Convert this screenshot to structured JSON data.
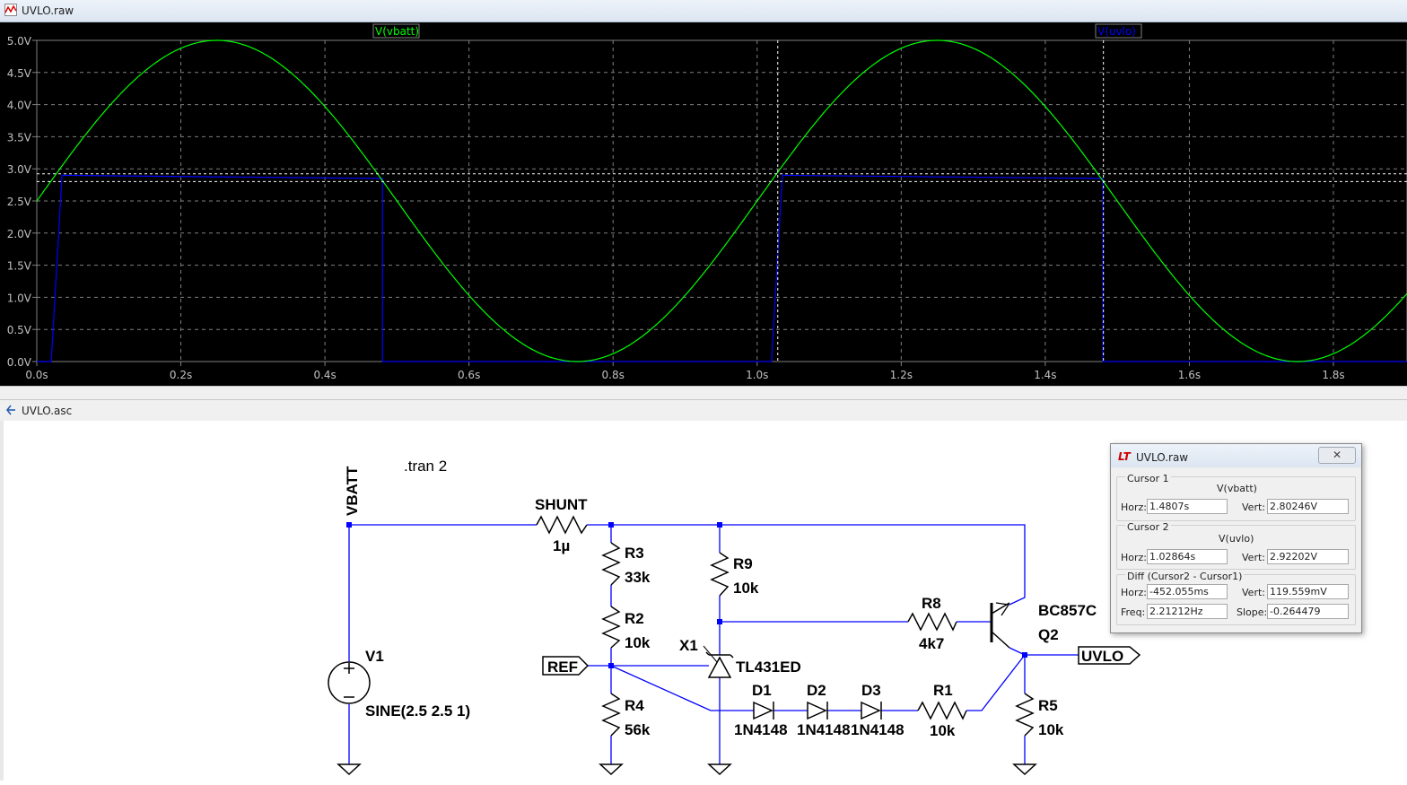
{
  "waveform_window": {
    "title": "UVLO.raw",
    "traces": [
      {
        "label": "V(vbatt)",
        "color": "#00ff00"
      },
      {
        "label": "V(uvlo)",
        "color": "#0000ff"
      }
    ],
    "y_ticks": [
      "0.0V",
      "0.5V",
      "1.0V",
      "1.5V",
      "2.0V",
      "2.5V",
      "3.0V",
      "3.5V",
      "4.0V",
      "4.5V",
      "5.0V"
    ],
    "x_ticks": [
      "0.0s",
      "0.2s",
      "0.4s",
      "0.6s",
      "0.8s",
      "1.0s",
      "1.2s",
      "1.4s",
      "1.6s",
      "1.8s"
    ]
  },
  "chart_data": {
    "type": "line",
    "x_range": [
      0,
      1.95
    ],
    "ylim": [
      0,
      5
    ],
    "grid": true,
    "series": [
      {
        "name": "V(vbatt)",
        "formula": "2.5 + 2.5*sin(2*pi*t)",
        "color": "#00ff00"
      },
      {
        "name": "V(uvlo)",
        "color": "#0000ff",
        "points": [
          [
            0,
            0
          ],
          [
            0.02,
            0
          ],
          [
            0.035,
            2.9
          ],
          [
            0.48,
            2.85
          ],
          [
            0.48,
            0
          ],
          [
            1.02,
            0
          ],
          [
            1.035,
            2.9
          ],
          [
            1.48,
            2.85
          ],
          [
            1.48,
            0
          ],
          [
            1.95,
            0
          ]
        ]
      }
    ],
    "cursors": {
      "cursor1_x": 1.4807,
      "cursor1_y": 2.80246,
      "cursor2_x": 1.02864,
      "cursor2_y": 2.92202
    }
  },
  "schematic_window": {
    "title": "UVLO.asc",
    "directive": ".tran 2",
    "nets": {
      "vbatt": "VBATT",
      "ref": "REF",
      "uvlo": "UVLO"
    },
    "components": {
      "shunt": {
        "name": "SHUNT",
        "value": "1µ"
      },
      "r3": {
        "name": "R3",
        "value": "33k"
      },
      "r2": {
        "name": "R2",
        "value": "10k"
      },
      "r4": {
        "name": "R4",
        "value": "56k"
      },
      "r9": {
        "name": "R9",
        "value": "10k"
      },
      "r8": {
        "name": "R8",
        "value": "4k7"
      },
      "r1": {
        "name": "R1",
        "value": "10k"
      },
      "r5": {
        "name": "R5",
        "value": "10k"
      },
      "x1": {
        "name": "X1",
        "value": "TL431ED"
      },
      "q2": {
        "name": "Q2",
        "value": "BC857C"
      },
      "v1": {
        "name": "V1",
        "value": "SINE(2.5 2.5 1)"
      },
      "d1": {
        "name": "D1",
        "value": "1N4148"
      },
      "d2": {
        "name": "D2",
        "value": "1N4148"
      },
      "d3": {
        "name": "D3",
        "value": "1N4148"
      }
    }
  },
  "cursor_dialog": {
    "title": "UVLO.raw",
    "close": "✕",
    "cursor1": {
      "label": "Cursor 1",
      "signal": "V(vbatt)",
      "horz_label": "Horz:",
      "horz": "1.4807s",
      "vert_label": "Vert:",
      "vert": "2.80246V"
    },
    "cursor2": {
      "label": "Cursor 2",
      "signal": "V(uvlo)",
      "horz_label": "Horz:",
      "horz": "1.02864s",
      "vert_label": "Vert:",
      "vert": "2.92202V"
    },
    "diff": {
      "label": "Diff (Cursor2 - Cursor1)",
      "horz_label": "Horz:",
      "horz": "-452.055ms",
      "vert_label": "Vert:",
      "vert": "119.559mV",
      "freq_label": "Freq:",
      "freq": "2.21212Hz",
      "slope_label": "Slope:",
      "slope": "-0.264479"
    }
  }
}
